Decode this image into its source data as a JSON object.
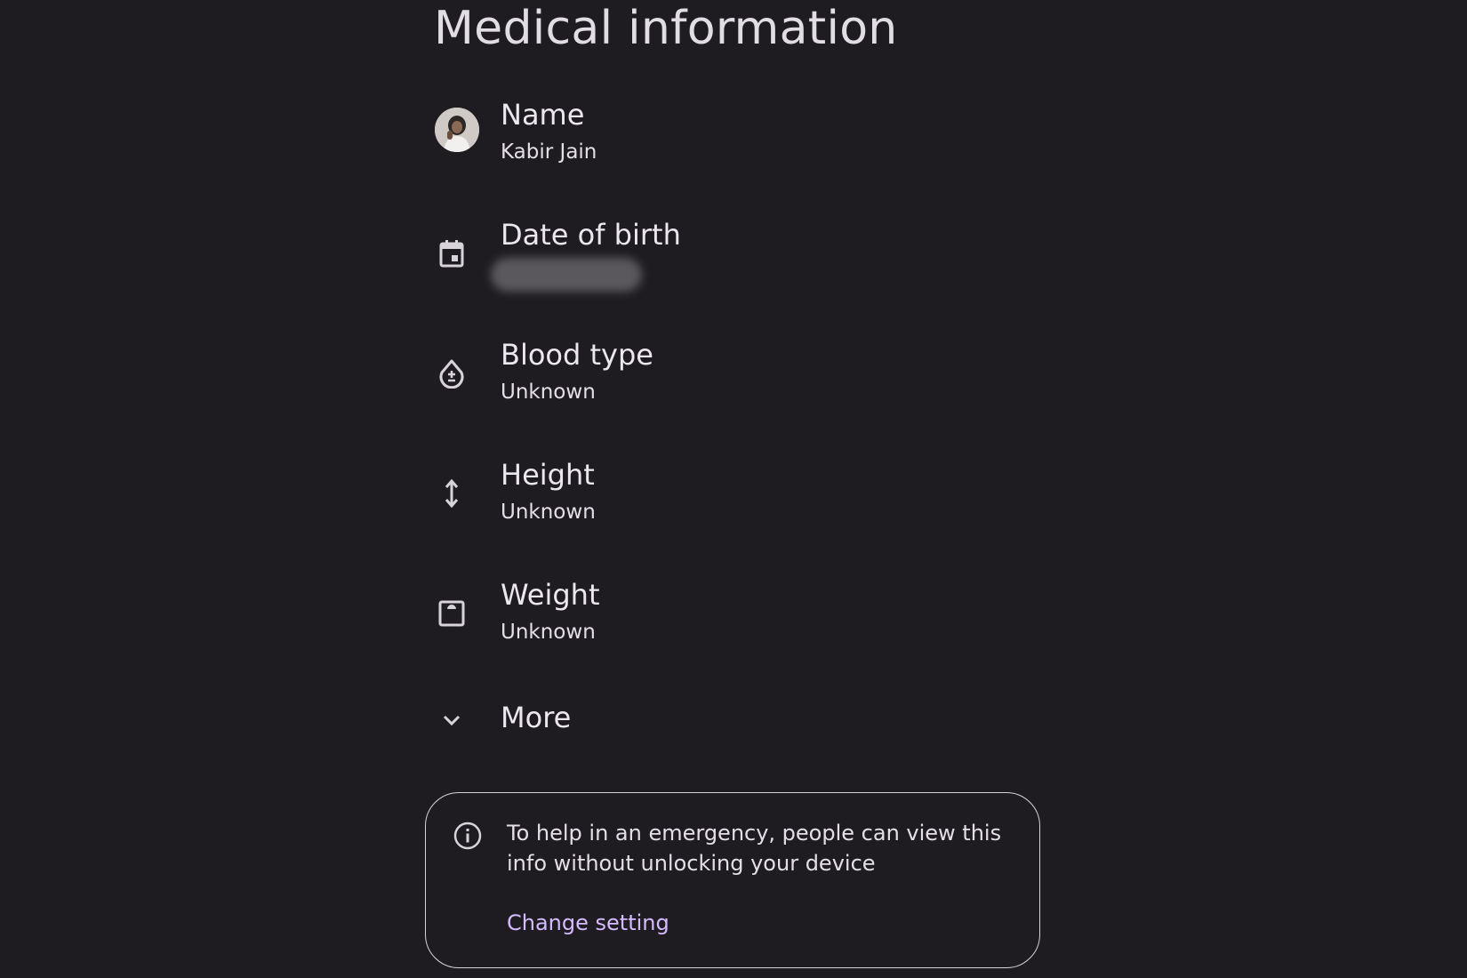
{
  "header": {
    "title": "Medical information"
  },
  "items": [
    {
      "label": "Name",
      "value": "Kabir Jain",
      "icon": "avatar"
    },
    {
      "label": "Date of birth",
      "value": "",
      "icon": "calendar-icon"
    },
    {
      "label": "Blood type",
      "value": "Unknown",
      "icon": "blood-drop-icon"
    },
    {
      "label": "Height",
      "value": "Unknown",
      "icon": "height-arrows-icon"
    },
    {
      "label": "Weight",
      "value": "Unknown",
      "icon": "scale-icon"
    }
  ],
  "more": {
    "label": "More",
    "icon": "chevron-down-icon"
  },
  "info_card": {
    "text": "To help in an emergency, people can view this info without unlocking your device",
    "link_label": "Change setting",
    "icon": "info-icon"
  },
  "colors": {
    "background": "#1f1c21",
    "text": "#ece6ee",
    "link": "#d4bbff",
    "border": "#d8d2da"
  }
}
